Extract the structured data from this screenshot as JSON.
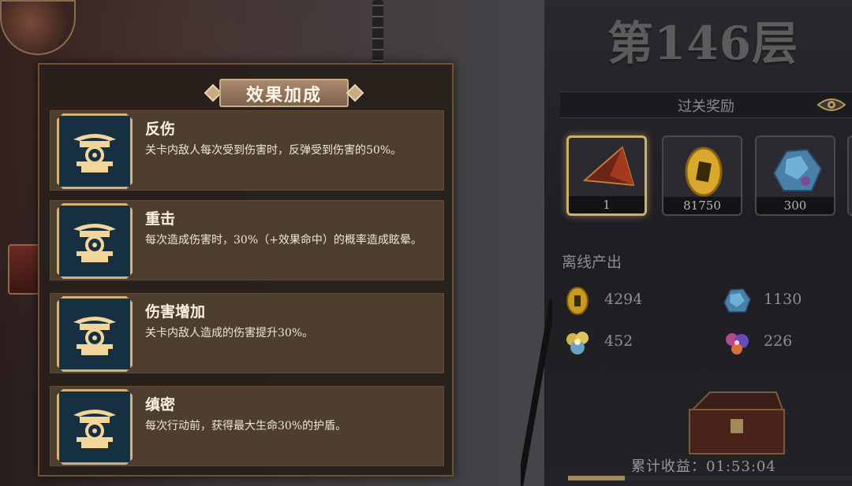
{
  "panel": {
    "title": "效果加成",
    "effects": [
      {
        "name": "反伤",
        "desc": "关卡内敌人每次受到伤害时，反弹受到伤害的50%。"
      },
      {
        "name": "重击",
        "desc": "每次造成伤害时，30%（+效果命中）的概率造成眩晕。"
      },
      {
        "name": "伤害增加",
        "desc": "关卡内敌人造成的伤害提升30%。"
      },
      {
        "name": "缜密",
        "desc": "每次行动前，获得最大生命30%的护盾。"
      }
    ]
  },
  "floor": {
    "title": "第146层"
  },
  "rewards": {
    "label": "过关奖励",
    "items": [
      {
        "icon": "red-gem-icon",
        "count": "1"
      },
      {
        "icon": "gold-coin-icon",
        "count": "81750"
      },
      {
        "icon": "blue-crystal-icon",
        "count": "300"
      }
    ]
  },
  "offline": {
    "title": "离线产出",
    "items": [
      {
        "icon": "gold-coin-icon",
        "value": "4294"
      },
      {
        "icon": "blue-crystal-icon",
        "value": "1130"
      },
      {
        "icon": "gold-flower-icon",
        "value": "452"
      },
      {
        "icon": "purple-flower-icon",
        "value": "226"
      }
    ]
  },
  "earnings": {
    "label": "累计收益：01:53:04",
    "progress": 0.2
  },
  "colors": {
    "panel_border": "#6b5436",
    "icon_bg": "#163042",
    "gold": "#cdb06a"
  }
}
